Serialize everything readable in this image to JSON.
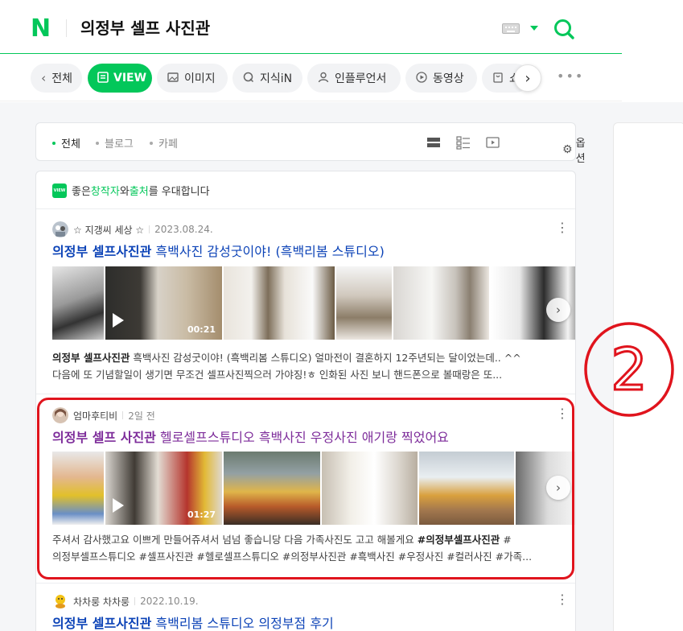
{
  "header": {
    "logo": "N",
    "query": "의정부 셀프 사진관",
    "icons": {
      "keyboard": "keyboard-icon",
      "dropdown": "chevron-down-icon",
      "search": "search-icon"
    },
    "brand_color": "#03c75a"
  },
  "tabs": [
    {
      "label": "전체",
      "icon": "chevron-left-icon"
    },
    {
      "label": "VIEW",
      "icon": "view-icon",
      "active": true
    },
    {
      "label": "이미지",
      "icon": "image-icon"
    },
    {
      "label": "지식iN",
      "icon": "q-icon"
    },
    {
      "label": "인플루언서",
      "icon": "person-icon"
    },
    {
      "label": "동영상",
      "icon": "play-icon"
    },
    {
      "label": "쇼",
      "icon": "shopping-icon"
    }
  ],
  "filters": [
    {
      "label": "전체",
      "active": true
    },
    {
      "label": "블로그",
      "active": false
    },
    {
      "label": "카페",
      "active": false
    }
  ],
  "options_label": "옵션",
  "notice": {
    "badge": "VIEW",
    "parts": [
      "좋은 ",
      "창작자",
      "와 ",
      "출처",
      "를 우대합니다"
    ]
  },
  "posts": [
    {
      "author": "☆ 지갱씨 세상 ☆",
      "date": "2023.08.24.",
      "title_bold": "의정부 셀프사진관",
      "title_rest": " 흑백사진 감성굿이야! (흑백리봄 스튜디오)",
      "video_duration": "00:21",
      "desc_line1_bold": "의정부 셀프사진관",
      "desc_line1_rest": " 흑백사진 감성굿이야! (흑백리봄 스튜디오) 얼마전이 결혼하지 12주년되는 달이었는데.. ^^",
      "desc_line2": "다음에 또 기념할일이 생기면 무조건 셀프사진찍으러 가야징!ㅎ 인화된 사진 보니 핸드폰으로 볼때랑은 또..."
    },
    {
      "author": "엄마후티비",
      "date": "2일 전",
      "title_bold": "의정부 셀프 사진관",
      "title_rest": " 헬로셀프스튜디오 흑백사진 우정사진 애기랑 찍었어요",
      "video_duration": "01:27",
      "desc_line1_pre": "주셔서 감사했고요 이쁘게 만들어쥬셔서 넘넘 좋습니당 다음 가족사진도 고고 해볼게요 ",
      "desc_line1_bold": "#의정부셀프사진관",
      "desc_line1_post": " #",
      "desc_line2": "의정부셀프스튜디오 #셀프사진관 #헬로셀프스튜디오 #의정부사진관 #흑백사진 #우정사진 #컬러사진 #가족..."
    },
    {
      "author": "차차룽 차차룽",
      "date": "2022.10.19.",
      "title_bold": "의정부 셀프사진관",
      "title_rest": " 흑백리봄 스튜디오 의정부점 후기"
    }
  ],
  "annotation": {
    "number": "2",
    "color": "#e0141d"
  }
}
